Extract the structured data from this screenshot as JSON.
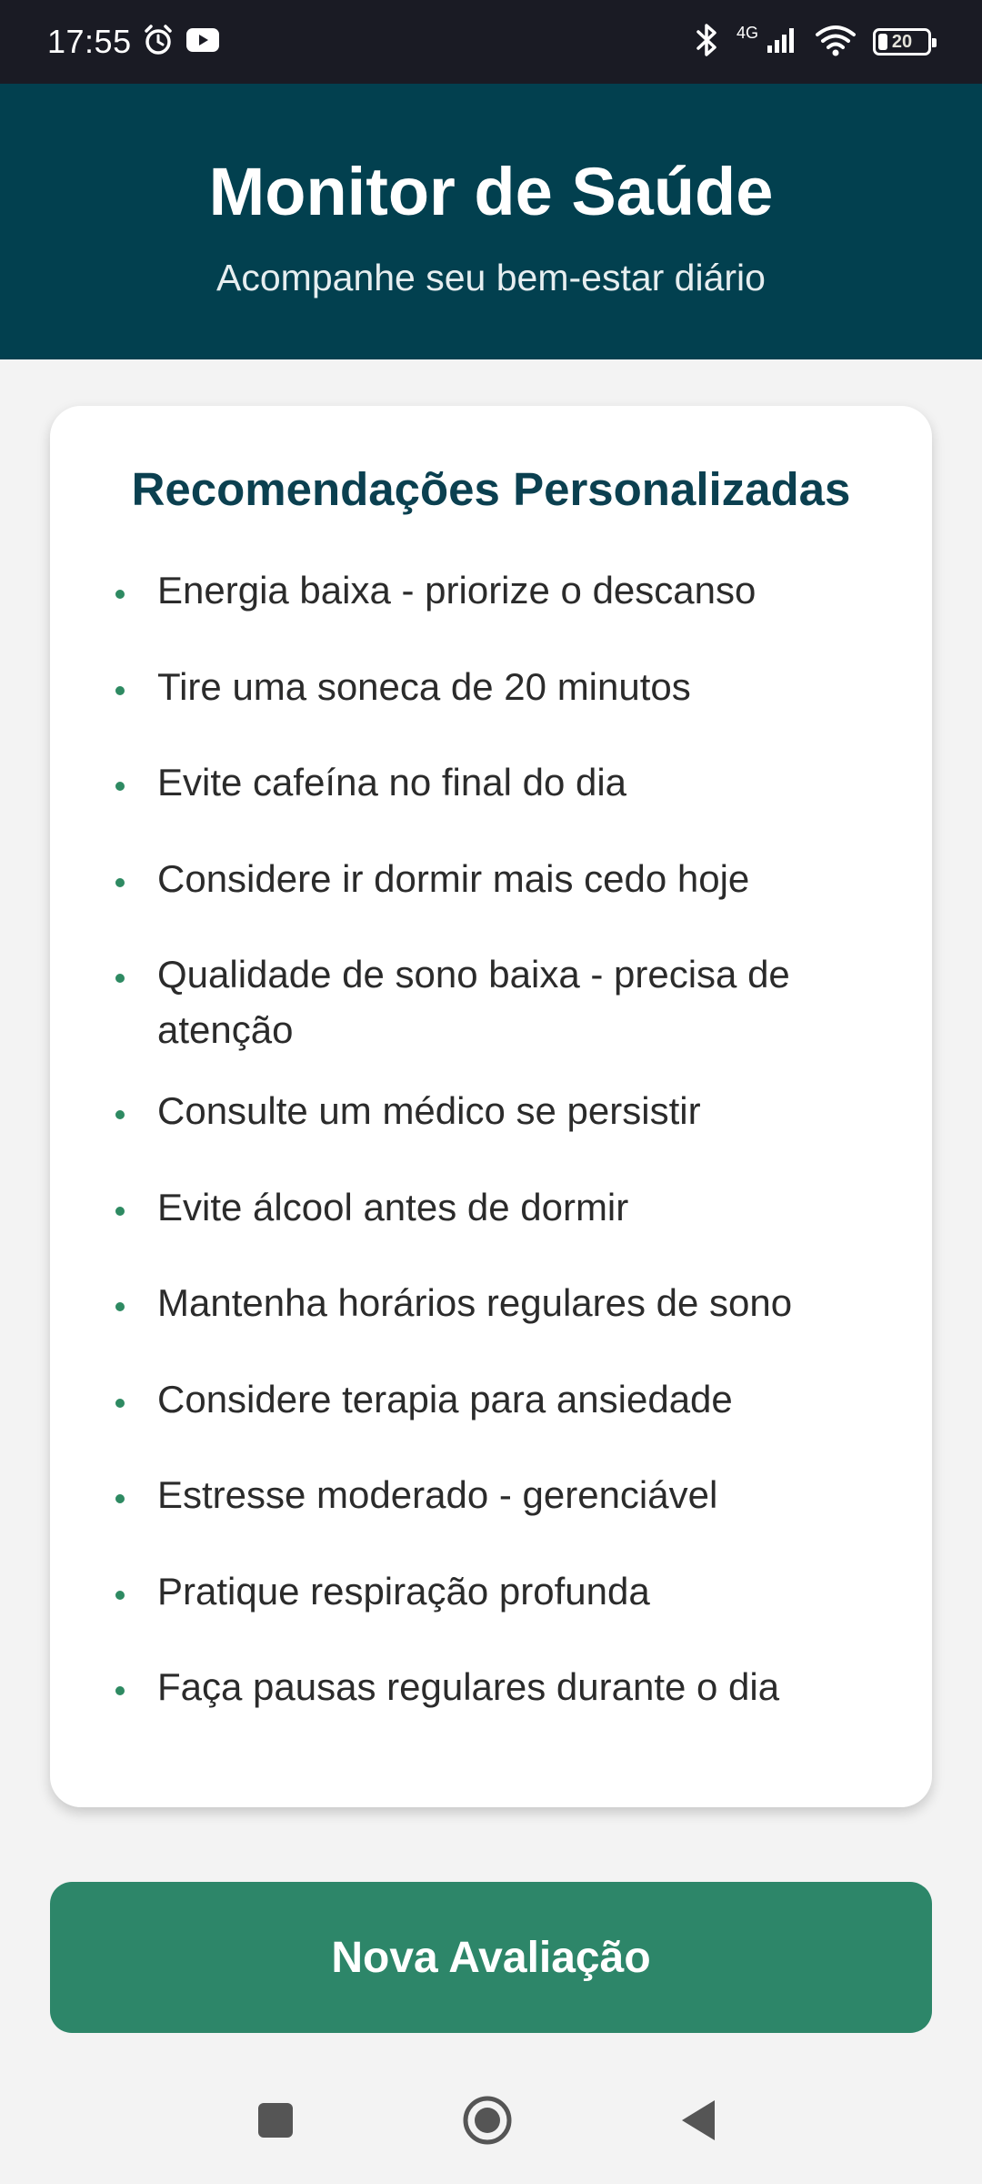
{
  "status_bar": {
    "time": "17:55",
    "network": "4G",
    "battery": "20",
    "battery_level": 0.2,
    "icons": [
      "alarm-icon",
      "youtube-icon",
      "bluetooth-icon",
      "signal-icon",
      "wifi-icon",
      "battery-icon"
    ]
  },
  "header": {
    "title": "Monitor de Saúde",
    "subtitle": "Acompanhe seu bem-estar diário",
    "background": "#02404f"
  },
  "recommendations": {
    "title": "Recomendações Personalizadas",
    "items": [
      "Energia baixa - priorize o descanso",
      "Tire uma soneca de 20 minutos",
      "Evite cafeína no final do dia",
      "Considere ir dormir mais cedo hoje",
      "Qualidade de sono baixa - precisa de atenção",
      "Consulte um médico se persistir",
      "Evite álcool antes de dormir",
      "Mantenha horários regulares de sono",
      "Considere terapia para ansiedade",
      "Estresse moderado - gerenciável",
      "Pratique respiração profunda",
      "Faça pausas regulares durante o dia"
    ],
    "bullet_color": "#2e8a62"
  },
  "actions": {
    "new_evaluation_label": "Nova Avaliação",
    "button_color": "#2d8669"
  },
  "nav_bar": {
    "buttons": [
      "recents-square-icon",
      "home-circle-icon",
      "back-triangle-icon"
    ]
  }
}
